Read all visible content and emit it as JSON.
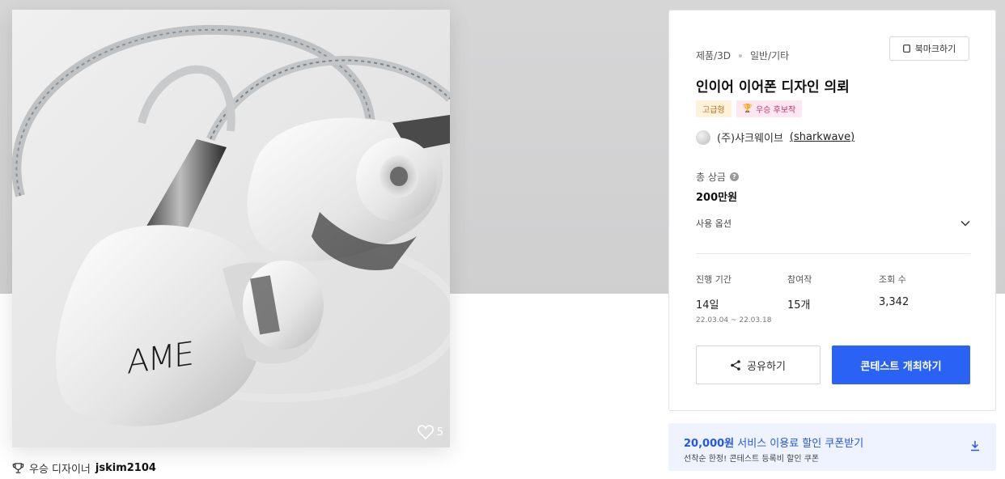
{
  "product_image": {
    "brand_mark": "AME",
    "like_count": "5"
  },
  "winner": {
    "prefix": "우승 디자이너",
    "name": "jskim2104"
  },
  "info": {
    "category": "제품/3D",
    "subcategory": "일반/기타",
    "bookmark_label": "북마크하기",
    "title": "인이어 이어폰 디자인 의뢰",
    "badges": {
      "premium": "고급형",
      "winner": "우승 후보작"
    },
    "company": {
      "name": "(주)샤크웨이브",
      "handle": "sharkwave"
    },
    "prize": {
      "label": "총 상금",
      "help_glyph": "?",
      "value": "200만원"
    },
    "options_label": "사용 옵션",
    "stats": {
      "period_label": "진행 기간",
      "period_value": "14일",
      "period_range": "22.03.04 ~ 22.03.18",
      "entries_label": "참여작",
      "entries_value": "15개",
      "views_label": "조회 수",
      "views_value": "3,342"
    },
    "share_label": "공유하기",
    "host_label": "콘테스트 개최하기"
  },
  "coupon": {
    "title_strong": "20,000원",
    "title_rest": "서비스 이용료 할인 쿠폰받기",
    "subtitle": "선착순 한정! 콘테스트 등록비 할인 쿠폰"
  },
  "colors": {
    "primary": "#2962f5",
    "hero_band": "#d3d3d4",
    "coupon_bg": "#eef3ff",
    "coupon_text": "#2457e6",
    "premium_badge_bg": "#fff2dc",
    "winner_badge_bg": "#fde7f1"
  },
  "icons": {
    "like": "heart-icon",
    "trophy": "trophy-icon",
    "bookmark": "bookmark-icon",
    "help": "help-icon",
    "chevron": "chevron-down-icon",
    "share": "share-icon",
    "download": "download-icon"
  }
}
